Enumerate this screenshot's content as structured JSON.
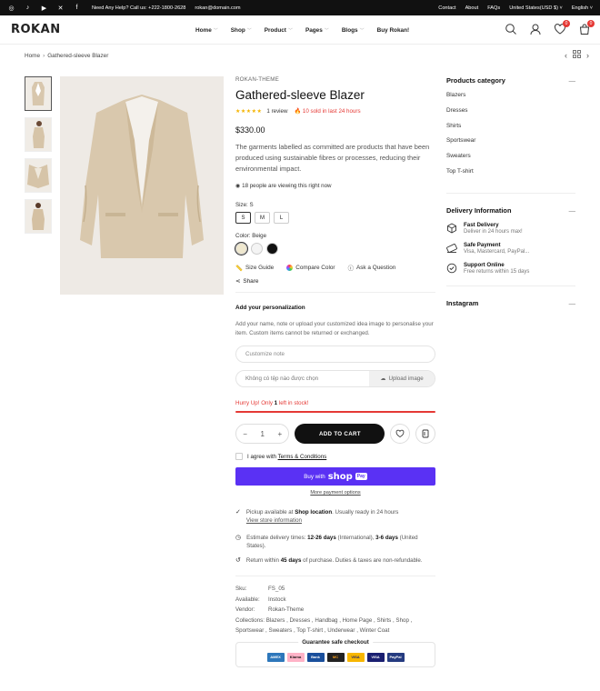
{
  "topbar": {
    "help": "Need Any Help? Call us: +222-1800-2628",
    "email": "rokan@domain.com",
    "links": [
      "Contact",
      "About",
      "FAQs",
      "United States(USD $)",
      "English"
    ]
  },
  "header": {
    "logo": "ROKAN",
    "nav": [
      "Home",
      "Shop",
      "Product",
      "Pages",
      "Blogs",
      "Buy Rokan!"
    ],
    "wishlist_count": "0",
    "cart_count": "0"
  },
  "breadcrumb": {
    "home": "Home",
    "current": "Gathered-sleeve Blazer"
  },
  "product": {
    "brand": "ROKAN-THEME",
    "title": "Gathered-sleeve Blazer",
    "stars": "★★★★★",
    "reviews": "1 review",
    "sold": "10 sold in last 24 hours",
    "price": "$330.00",
    "description": "The garments labelled as committed are products that have been produced using sustainable fibres or processes, reducing their environmental impact.",
    "viewing": "18 people are viewing this right now",
    "size_label": "Size: S",
    "sizes": [
      "S",
      "M",
      "L"
    ],
    "color_label": "Color: Beige",
    "colors": [
      "#efe8cf",
      "#f4f4f4",
      "#111111"
    ],
    "tools": {
      "size_guide": "Size Guide",
      "compare": "Compare Color",
      "ask": "Ask a Question",
      "share": "Share"
    },
    "personalization": {
      "title": "Add your personalization",
      "desc": "Add your name, note or upload your customized idea image to personalise your item. Custom items cannot be returned or exchanged.",
      "note_placeholder": "Customize note",
      "file_text": "Không có tệp nào được chọn",
      "upload": "Upload image"
    },
    "stock": {
      "prefix": "Hurry Up! Only ",
      "count": "1",
      "suffix": " left in stock!"
    },
    "quantity": "1",
    "add_to_cart": "ADD TO CART",
    "agree_prefix": "I agree with ",
    "agree_link": "Terms & Conditions",
    "shoppay_prefix": "Buy with",
    "shoppay_brand": "shop",
    "shoppay_badge": "Pay",
    "more_options": "More payment options",
    "pickup": {
      "pre": "Pickup available at ",
      "loc": "Shop location",
      "post": ". Usually ready in 24 hours",
      "link": "View store information"
    },
    "delivery": {
      "pre": "Estimate delivery times: ",
      "intl": "12-26 days",
      "mid": " (International), ",
      "us": "3-6 days",
      "post": " (United States)."
    },
    "returns": {
      "pre": "Return within ",
      "days": "45 days",
      "post": " of purchase. Duties & taxes are non-refundable."
    },
    "meta": {
      "sku_k": "Sku:",
      "sku": "FS_05",
      "avail_k": "Available:",
      "avail": "Instock",
      "vendor_k": "Vendor:",
      "vendor": "Rokan-Theme",
      "collections_k": "Collections:",
      "collections": "Blazers , Dresses , Handbag , Home Page , Shirts , Shop , Sportswear , Sweaters , Top T-shirt , Underwear , Winter Coat"
    },
    "guarantee": "Guarantee safe checkout",
    "payments": [
      "AMEX",
      "Klarna",
      "Bank",
      "MC",
      "VISA",
      "VISA",
      "PayPal"
    ]
  },
  "sidebar": {
    "categories_title": "Products category",
    "categories": [
      "Blazers",
      "Dresses",
      "Shirts",
      "Sportswear",
      "Sweaters",
      "Top T-shirt"
    ],
    "delivery_title": "Delivery Information",
    "delivery": [
      {
        "title": "Fast Delivery",
        "sub": "Deliver in 24 hours max!"
      },
      {
        "title": "Safe Payment",
        "sub": "Visa, Mastercard, PayPal..."
      },
      {
        "title": "Support Online",
        "sub": "Free returns within 15 days"
      }
    ],
    "instagram_title": "Instagram"
  },
  "colors": {
    "accent": "#e53935",
    "shoppay": "#5a31f4",
    "dark": "#111111",
    "star": "#f5b400"
  }
}
